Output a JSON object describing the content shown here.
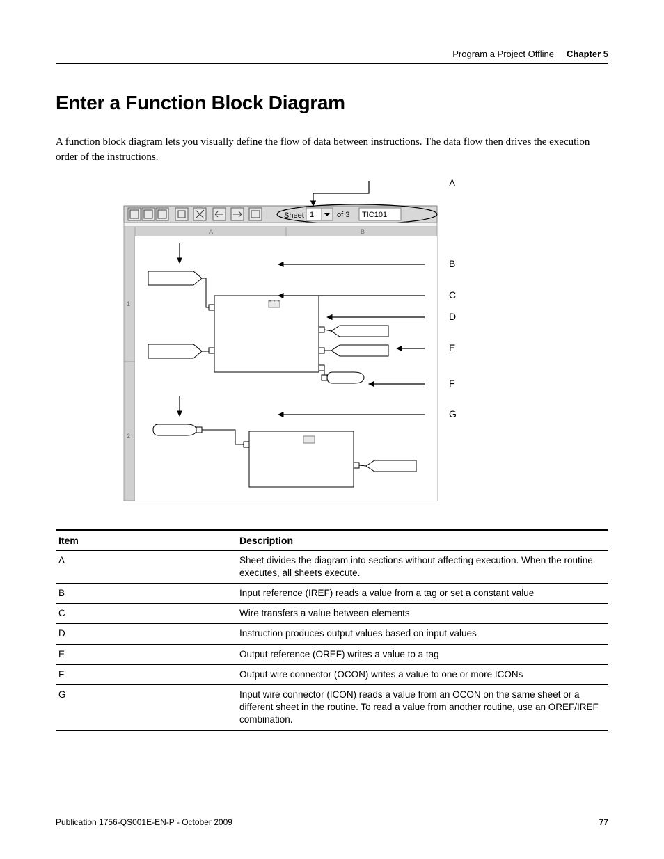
{
  "header": {
    "section": "Program a Project Offline",
    "chapter": "Chapter 5"
  },
  "heading": "Enter a Function Block Diagram",
  "intro": "A function block diagram lets you visually define the flow of data between instructions. The data flow then drives the execution order of the instructions.",
  "diagram": {
    "toolbar": {
      "sheet_label": "Sheet",
      "sheet_num": "1",
      "of_label": "of 3",
      "name": "TIC101"
    },
    "cols": {
      "A": "A",
      "B": "B"
    },
    "rows": {
      "r1": "1",
      "r2": "2"
    },
    "callouts": {
      "A": "A",
      "B": "B",
      "C": "C",
      "D": "D",
      "E": "E",
      "F": "F",
      "G": "G"
    }
  },
  "table": {
    "headers": {
      "item": "Item",
      "desc": "Description"
    },
    "rows": [
      {
        "item": "A",
        "desc": "Sheet divides the diagram into sections without affecting execution. When the routine executes, all sheets execute."
      },
      {
        "item": "B",
        "desc": "Input reference (IREF) reads a value from a tag or set a constant value"
      },
      {
        "item": "C",
        "desc": "Wire transfers a value between elements"
      },
      {
        "item": "D",
        "desc": "Instruction produces output values based on input values"
      },
      {
        "item": "E",
        "desc": "Output reference (OREF) writes a value to a tag"
      },
      {
        "item": "F",
        "desc": "Output wire connector (OCON) writes a value to one or more ICONs"
      },
      {
        "item": "G",
        "desc": "Input wire connector (ICON) reads a value from an OCON on the same sheet or a different sheet in the routine. To read a value from another routine, use an OREF/IREF combination."
      }
    ]
  },
  "footer": {
    "pub": "Publication 1756-QS001E-EN-P - October 2009",
    "page": "77"
  }
}
